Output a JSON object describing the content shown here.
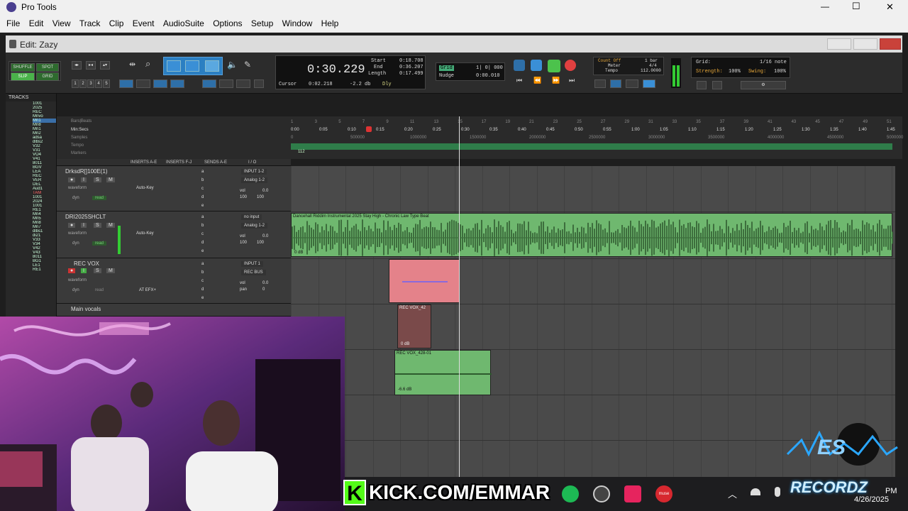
{
  "app": {
    "title": "Pro Tools"
  },
  "window_controls": {
    "minimize": "—",
    "maximize": "☐",
    "close": "✕"
  },
  "menu": [
    "File",
    "Edit",
    "View",
    "Track",
    "Clip",
    "Event",
    "AudioSuite",
    "Options",
    "Setup",
    "Window",
    "Help"
  ],
  "edit_window": {
    "title": "Edit: Zazy"
  },
  "toolbar": {
    "modes": [
      "SHUFFLE",
      "SPOT",
      "SLIP",
      "GRID"
    ],
    "zoom_presets": [
      "1",
      "2",
      "3",
      "4",
      "5"
    ],
    "main_counter": "0:30.229",
    "start_label": "Start",
    "start_value": "0:18.708",
    "end_label": "End",
    "end_value": "0:36.207",
    "length_label": "Length",
    "length_value": "0:17.499",
    "cursor_label": "Cursor",
    "cursor_value": "0:02.218",
    "cursor_db": "-2.2 db",
    "dly_label": "Dly",
    "grid_label": "Grid",
    "grid_value": "1| 0| 000",
    "nudge_label": "Nudge",
    "nudge_value": "0:00.010",
    "count_off": "Count Off",
    "meter_label": "Meter",
    "tempo_label": "Tempo",
    "count_value": "1 bar",
    "meter_value": "4/4",
    "tempo_value": "112.0000",
    "grid_note": "1/16 note",
    "strength_label": "Strength:",
    "strength_value": "100%",
    "swing_label": "Swing:",
    "swing_value": "100%",
    "grid_title": "Grid:"
  },
  "tracks_panel": {
    "header": "TRACKS",
    "items": [
      "1001",
      "2025",
      "REC",
      "Mnvo",
      "Mn1",
      "Mn8",
      "Mn1",
      "Mn2",
      "adsa",
      "dlbs2",
      "V32",
      "V31",
      "VO4",
      "V41",
      "8011",
      "BGV",
      "LEA",
      "REC",
      "VER",
      "DEL",
      "Aud1",
      "TAM",
      "1001",
      "2024",
      "1001",
      "RE1",
      "Mn4",
      "Mn5",
      "Mn8",
      "Mn7",
      "dlbs1",
      "di21",
      "V33",
      "V34",
      "V42",
      "V43",
      "8011",
      "BG1",
      "LE1",
      "RE1"
    ]
  },
  "rulers": {
    "labels": [
      "Bars|Beats",
      "Min:Secs",
      "Samples",
      "Tempo",
      "Markers"
    ],
    "bars": [
      "1",
      "3",
      "5",
      "7",
      "9",
      "11",
      "13",
      "15",
      "17",
      "19",
      "21",
      "23",
      "25",
      "27",
      "29",
      "31",
      "33",
      "35",
      "37",
      "39",
      "41",
      "43",
      "45",
      "47",
      "49",
      "51"
    ],
    "secs": [
      "0:00",
      "0:05",
      "0:10",
      "0:15",
      "0:20",
      "0:25",
      "0:30",
      "0:35",
      "0:40",
      "0:45",
      "0:50",
      "0:55",
      "1:00",
      "1:05",
      "1:10",
      "1:15",
      "1:20",
      "1:25",
      "1:30",
      "1:35",
      "1:40",
      "1:45"
    ],
    "samples": [
      "0",
      "500000",
      "1000000",
      "1500000",
      "2000000",
      "2500000",
      "3000000",
      "3500000",
      "4000000",
      "4500000",
      "5000000"
    ],
    "tempo": "112"
  },
  "mix_header": {
    "inserts_ae": "INSERTS A-E",
    "inserts_fj": "INSERTS F-J",
    "sends_ae": "SENDS A-E",
    "io": "I / O"
  },
  "tracks": [
    {
      "name": "DrksdR[]100E(1)",
      "input": "INPUT 1-2",
      "output": "Analog 1-2",
      "view": "waveform",
      "vol": "0.0",
      "pan": "100",
      "pan2": "100",
      "plugin": "Auto-Key",
      "dyn": "dyn",
      "read": "read"
    },
    {
      "name": "DRI2025SHCLT",
      "input": "no input",
      "output": "Analog 1-2",
      "view": "waveform",
      "vol": "0.0",
      "pan": "100",
      "pan2": "100",
      "plugin": "Auto-Key",
      "dyn": "dyn",
      "read": "read"
    },
    {
      "name": "REC VOX",
      "input": "INPUT 1",
      "output": "REC BUS",
      "view": "waveform",
      "vol": "0.0",
      "pan_label": "pan",
      "pan": "0",
      "plugin": "AT EFX+",
      "dyn": "dyn",
      "read": "read"
    },
    {
      "name": "Main vocals"
    }
  ],
  "track_button_labels": {
    "rec": "●",
    "input": "I",
    "solo": "S",
    "mute": "M",
    "vol": "vol",
    "pan": "pan"
  },
  "insert_slot_letters": [
    "a",
    "b",
    "c",
    "d",
    "e"
  ],
  "clips": {
    "beat": {
      "name": "Dancehall Riddim Instrumental 2025 Stay High - Chronic Law Type Beat",
      "gain": "0 dB"
    },
    "rec_vox_42": {
      "name": "REC VOX_42",
      "gain": "0 dB"
    },
    "rec_vox_428": {
      "name": "REC VOX_428-01",
      "gain": "-6.6 dB"
    }
  },
  "overlay": {
    "kick_banner": "KICK.COM/EMMAR",
    "kick_logo": "K",
    "logo_text": "RECORDZ",
    "logo_initials": "ES",
    "date": "4/26/2025",
    "time_fragment": "PM"
  },
  "taskbar": {
    "muse_label": "muse"
  },
  "colors": {
    "accent_green": "#6cbf6c",
    "rec_red": "#e05050",
    "clip_pink": "#e4828a",
    "transport_blue": "#2e8fc8",
    "kick_green": "#53fc18"
  }
}
